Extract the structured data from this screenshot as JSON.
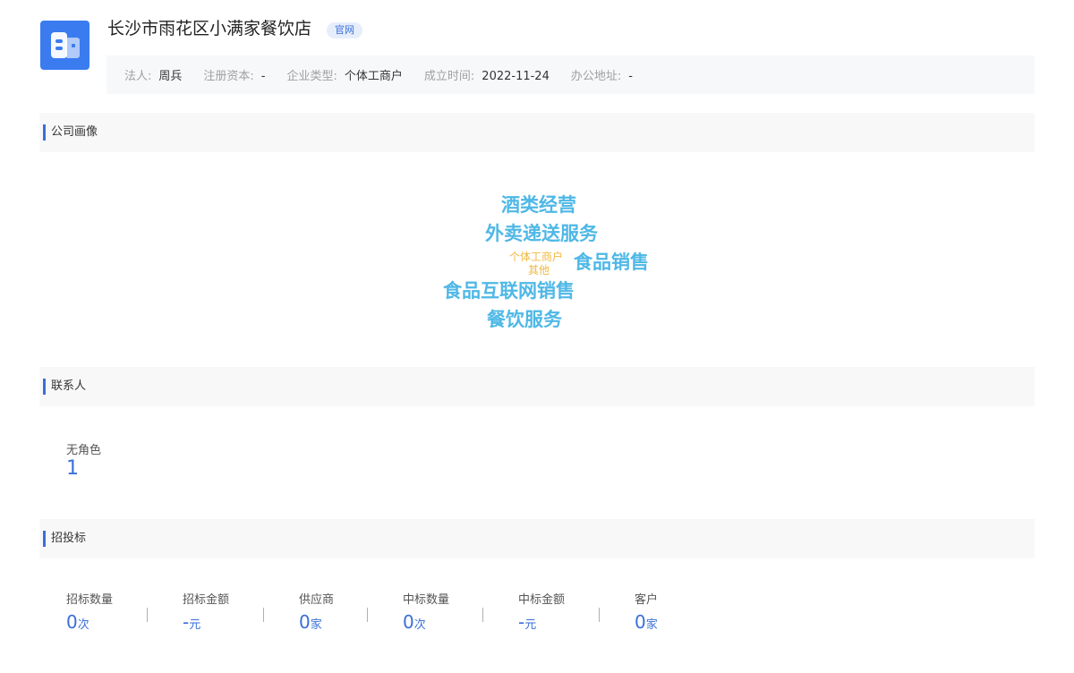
{
  "header": {
    "company_name": "长沙市雨花区小满家餐饮店",
    "tag": "官网",
    "info": [
      {
        "label": "法人:",
        "value": "周兵"
      },
      {
        "label": "注册资本:",
        "value": "-"
      },
      {
        "label": "企业类型:",
        "value": "个体工商户"
      },
      {
        "label": "成立时间:",
        "value": "2022-11-24"
      },
      {
        "label": "办公地址:",
        "value": "-"
      }
    ]
  },
  "sections": {
    "portrait": "公司画像",
    "contacts": "联系人",
    "bidding": "招投标"
  },
  "word_cloud": {
    "words": [
      {
        "text": "酒类经营",
        "color": "#4fb8e6"
      },
      {
        "text": "外卖递送服务",
        "color": "#4fb8e6"
      },
      {
        "text": "个体工商户",
        "color": "#f0b841"
      },
      {
        "text": "其他",
        "color": "#f0b841"
      },
      {
        "text": "食品销售",
        "color": "#4fb8e6"
      },
      {
        "text": "食品互联网销售",
        "color": "#4fb8e6"
      },
      {
        "text": "餐饮服务",
        "color": "#4fb8e6"
      }
    ]
  },
  "contacts": {
    "role": "无角色",
    "count": "1"
  },
  "bidding": {
    "stats": [
      {
        "label": "招标数量",
        "value": "0",
        "unit": "次"
      },
      {
        "label": "招标金额",
        "value": "-",
        "unit": "元"
      },
      {
        "label": "供应商",
        "value": "0",
        "unit": "家"
      },
      {
        "label": "中标数量",
        "value": "0",
        "unit": "次"
      },
      {
        "label": "中标金额",
        "value": "-",
        "unit": "元"
      },
      {
        "label": "客户",
        "value": "0",
        "unit": "家"
      }
    ]
  },
  "colors": {
    "accent": "#3a6fd8",
    "logo": "#3a7bf0",
    "cloud_primary": "#4fb8e6",
    "cloud_secondary": "#f0b841"
  },
  "icons": {
    "logo": "building-icon"
  }
}
